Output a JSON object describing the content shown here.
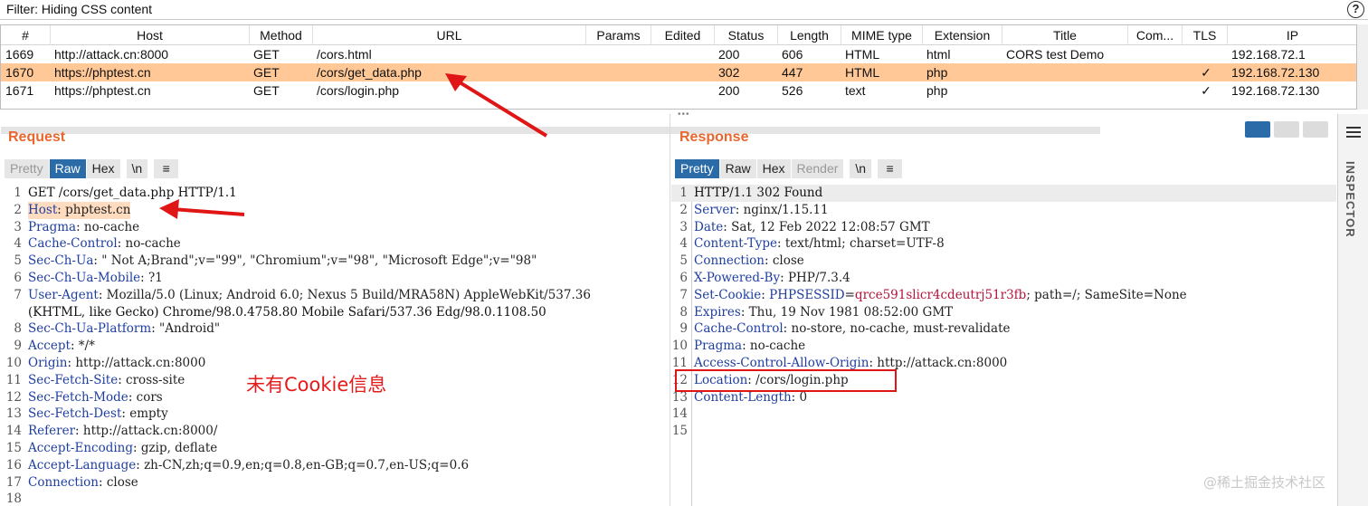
{
  "filter": {
    "text": "Filter: Hiding CSS content",
    "help": "?"
  },
  "table": {
    "headers": [
      "#",
      "Host",
      "Method",
      "URL",
      "Params",
      "Edited",
      "Status",
      "Length",
      "MIME type",
      "Extension",
      "Title",
      "Com...",
      "TLS",
      "IP"
    ],
    "rows": [
      {
        "num": "1669",
        "host": "http://attack.cn:8000",
        "method": "GET",
        "url": "/cors.html",
        "params": "",
        "edited": "",
        "status": "200",
        "length": "606",
        "mime": "HTML",
        "ext": "html",
        "title": "CORS test Demo",
        "comment": "",
        "tls": "",
        "ip": "192.168.72.1"
      },
      {
        "num": "1670",
        "host": "https://phptest.cn",
        "method": "GET",
        "url": "/cors/get_data.php",
        "params": "",
        "edited": "",
        "status": "302",
        "length": "447",
        "mime": "HTML",
        "ext": "php",
        "title": "",
        "comment": "",
        "tls": "✓",
        "ip": "192.168.72.130"
      },
      {
        "num": "1671",
        "host": "https://phptest.cn",
        "method": "GET",
        "url": "/cors/login.php",
        "params": "",
        "edited": "",
        "status": "200",
        "length": "526",
        "mime": "text",
        "ext": "php",
        "title": "",
        "comment": "",
        "tls": "✓",
        "ip": "192.168.72.130"
      }
    ],
    "selected_row": 1
  },
  "request": {
    "title": "Request",
    "tabs": [
      "Pretty",
      "Raw",
      "Hex",
      "\\n"
    ],
    "active_tab": "Raw",
    "lines": [
      {
        "n": "1",
        "text": "GET /cors/get_data.php HTTP/1.1"
      },
      {
        "n": "2",
        "name": "Host",
        "value": "phptest.cn",
        "highlight": true
      },
      {
        "n": "3",
        "name": "Pragma",
        "value": "no-cache"
      },
      {
        "n": "4",
        "name": "Cache-Control",
        "value": "no-cache"
      },
      {
        "n": "5",
        "name": "Sec-Ch-Ua",
        "value": "\" Not A;Brand\";v=\"99\", \"Chromium\";v=\"98\", \"Microsoft Edge\";v=\"98\""
      },
      {
        "n": "6",
        "name": "Sec-Ch-Ua-Mobile",
        "value": "?1"
      },
      {
        "n": "7",
        "name": "User-Agent",
        "value": "Mozilla/5.0 (Linux; Android 6.0; Nexus 5 Build/MRA58N) AppleWebKit/537.36"
      },
      {
        "n": "",
        "text": "(KHTML, like Gecko) Chrome/98.0.4758.80 Mobile Safari/537.36 Edg/98.0.1108.50"
      },
      {
        "n": "8",
        "name": "Sec-Ch-Ua-Platform",
        "value": "\"Android\""
      },
      {
        "n": "9",
        "name": "Accept",
        "value": "*/*"
      },
      {
        "n": "10",
        "name": "Origin",
        "value": "http://attack.cn:8000"
      },
      {
        "n": "11",
        "name": "Sec-Fetch-Site",
        "value": "cross-site"
      },
      {
        "n": "12",
        "name": "Sec-Fetch-Mode",
        "value": "cors"
      },
      {
        "n": "13",
        "name": "Sec-Fetch-Dest",
        "value": "empty"
      },
      {
        "n": "14",
        "name": "Referer",
        "value": "http://attack.cn:8000/"
      },
      {
        "n": "15",
        "name": "Accept-Encoding",
        "value": "gzip, deflate"
      },
      {
        "n": "16",
        "name": "Accept-Language",
        "value": "zh-CN,zh;q=0.9,en;q=0.8,en-GB;q=0.7,en-US;q=0.6"
      },
      {
        "n": "17",
        "name": "Connection",
        "value": "close"
      },
      {
        "n": "18",
        "text": ""
      }
    ]
  },
  "response": {
    "title": "Response",
    "tabs": [
      "Pretty",
      "Raw",
      "Hex",
      "Render",
      "\\n"
    ],
    "active_tab": "Pretty",
    "lines": [
      {
        "n": "1",
        "text": "HTTP/1.1 302 Found"
      },
      {
        "n": "2",
        "name": "Server",
        "value": "nginx/1.15.11"
      },
      {
        "n": "3",
        "name": "Date",
        "value": "Sat, 12 Feb 2022 12:08:57 GMT"
      },
      {
        "n": "4",
        "name": "Content-Type",
        "value": "text/html; charset=UTF-8"
      },
      {
        "n": "5",
        "name": "Connection",
        "value": "close"
      },
      {
        "n": "6",
        "name": "X-Powered-By",
        "value": "PHP/7.3.4"
      },
      {
        "n": "7",
        "name": "Set-Cookie",
        "cookie_name": "PHPSESSID",
        "cookie_value": "qrce591slicr4cdeutrj51r3fb",
        "value": "; path=/; SameSite=None"
      },
      {
        "n": "8",
        "name": "Expires",
        "value": "Thu, 19 Nov 1981 08:52:00 GMT"
      },
      {
        "n": "9",
        "name": "Cache-Control",
        "value": "no-store, no-cache, must-revalidate"
      },
      {
        "n": "10",
        "name": "Pragma",
        "value": "no-cache"
      },
      {
        "n": "11",
        "name": "Access-Control-Allow-Origin",
        "value": "http://attack.cn:8000"
      },
      {
        "n": "12",
        "name": "Location",
        "value": "/cors/login.php"
      },
      {
        "n": "13",
        "name": "Content-Length",
        "value": "0"
      },
      {
        "n": "14",
        "text": ""
      },
      {
        "n": "15",
        "text": ""
      }
    ]
  },
  "annotation": {
    "text": "未有Cookie信息",
    "color": "#e41b1b"
  },
  "inspector": {
    "label": "INSPECTOR"
  },
  "watermark": "@稀土掘金技术社区",
  "colors": {
    "accent": "#e8672e",
    "selected_row": "#ffc896",
    "tab_active": "#2a6ba8",
    "header_name": "#1f3fa0",
    "cookie_value": "#b4143c"
  }
}
